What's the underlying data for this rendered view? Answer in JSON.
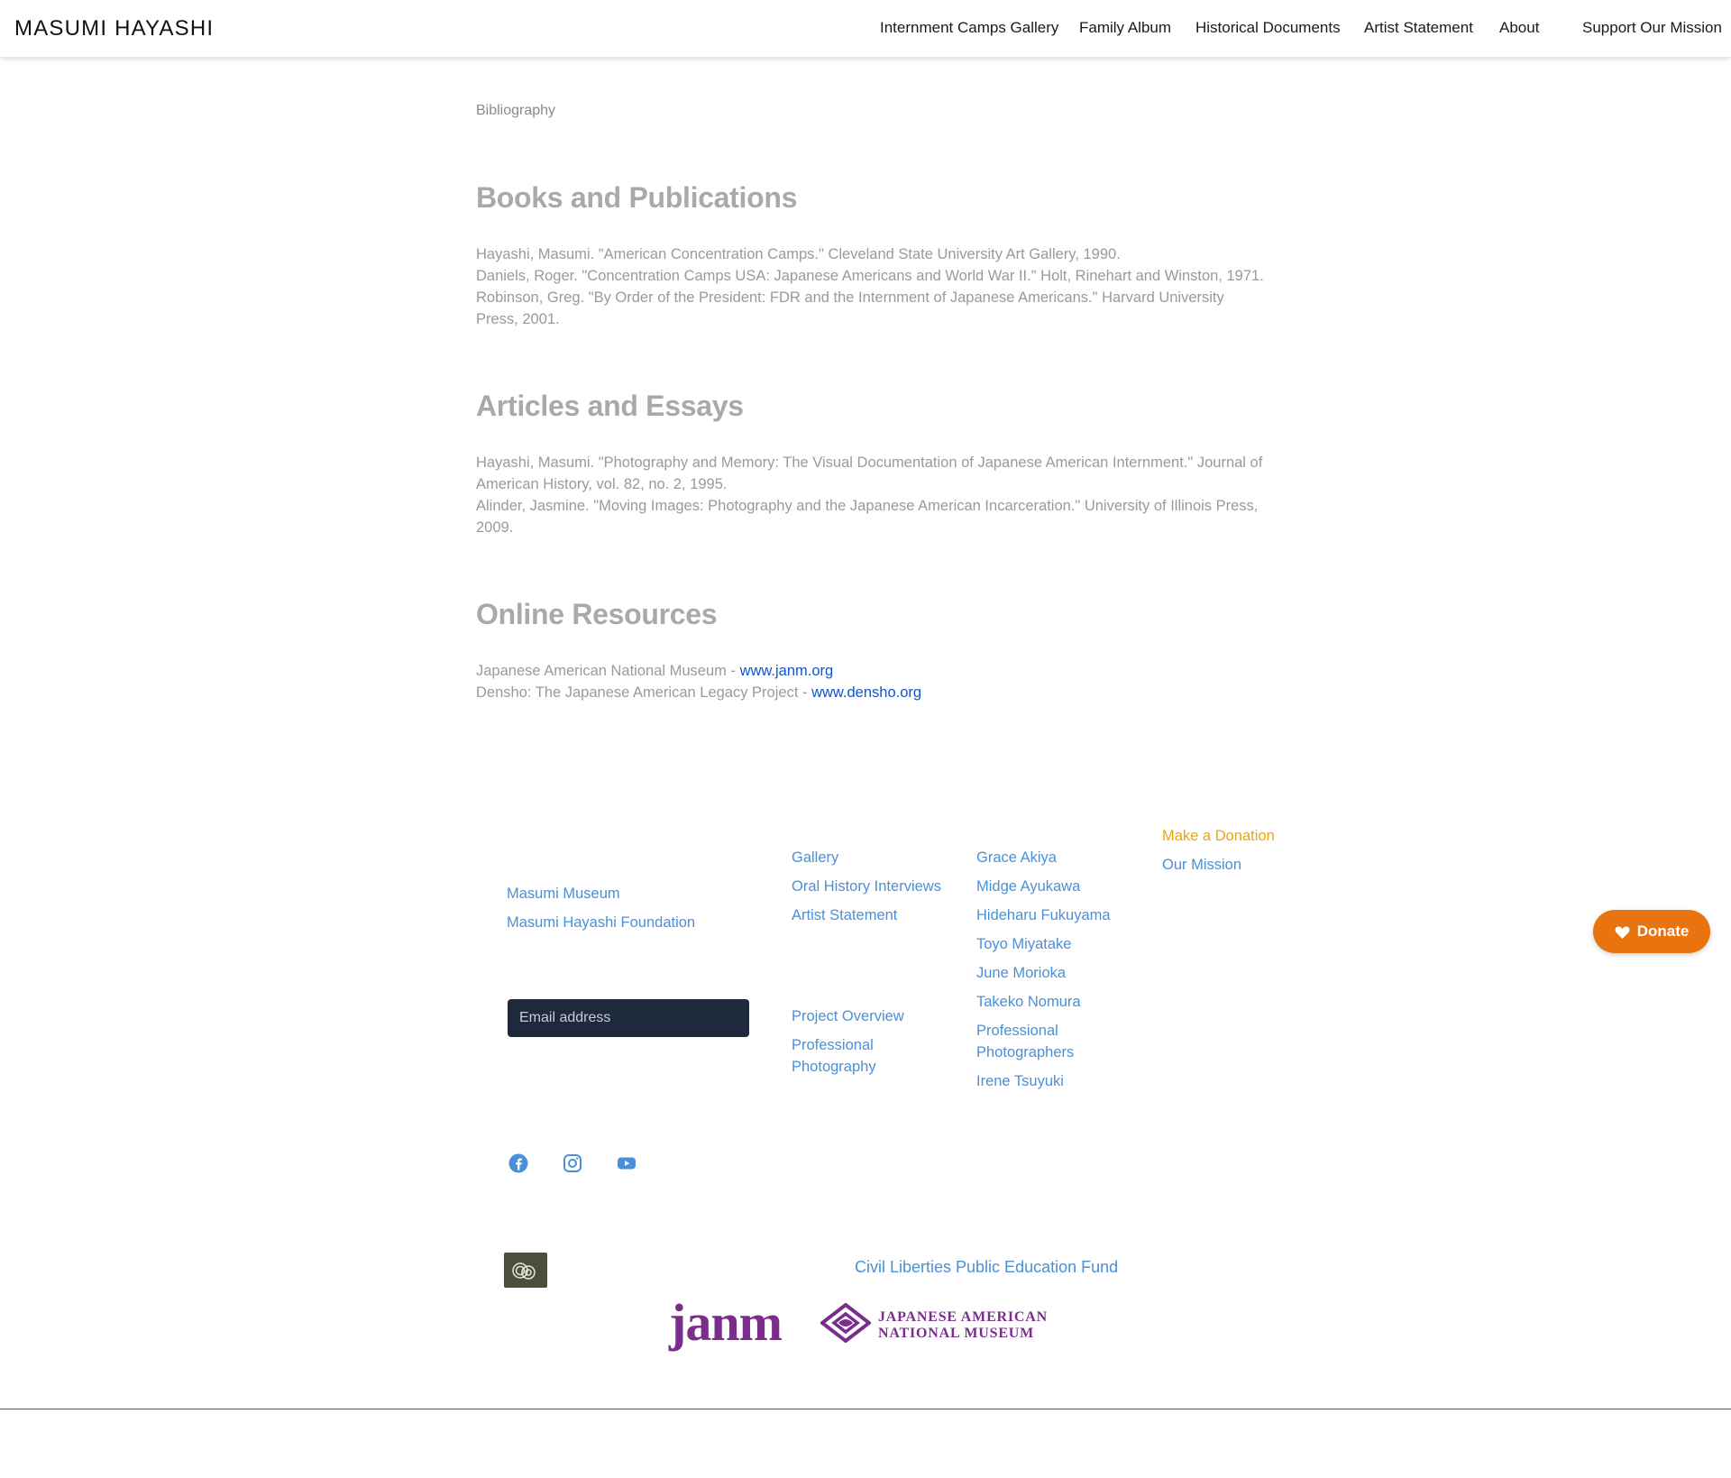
{
  "header": {
    "brand": "MASUMI HAYASHI",
    "nav": [
      {
        "label": "Internment Camps Gallery"
      },
      {
        "label": "Family Album"
      },
      {
        "label": "Historical Documents"
      },
      {
        "label": "Artist Statement"
      },
      {
        "label": "About"
      },
      {
        "label": "Support Our Mission"
      }
    ]
  },
  "main": {
    "breadcrumb": "Bibliography",
    "sections": [
      {
        "title": "Books and Publications",
        "entries": [
          "Hayashi, Masumi. \"American Concentration Camps.\" Cleveland State University Art Gallery, 1990.",
          "Daniels, Roger. \"Concentration Camps USA: Japanese Americans and World War II.\" Holt, Rinehart and Winston, 1971.",
          "Robinson, Greg. \"By Order of the President: FDR and the Internment of Japanese Americans.\" Harvard University Press, 2001."
        ]
      },
      {
        "title": "Articles and Essays",
        "entries": [
          "Hayashi, Masumi. \"Photography and Memory: The Visual Documentation of Japanese American Internment.\" Journal of American History, vol. 82, no. 2, 1995.",
          "Alinder, Jasmine. \"Moving Images: Photography and the Japanese American Incarceration.\" University of Illinois Press, 2009."
        ]
      },
      {
        "title": "Online Resources",
        "resources": [
          {
            "text": "Japanese American National Museum - ",
            "link": "www.janm.org"
          },
          {
            "text": "Densho: The Japanese American Legacy Project - ",
            "link": "www.densho.org"
          }
        ]
      }
    ]
  },
  "footer": {
    "col1": [
      "Masumi Museum",
      "Masumi Hayashi Foundation"
    ],
    "email_placeholder": "Email address",
    "col2_top": [
      "Gallery",
      "Oral History Interviews",
      "Artist Statement"
    ],
    "col2_bottom": [
      "Project Overview",
      "Professional Photography"
    ],
    "col3": [
      "Grace Akiya",
      "Midge Ayukawa",
      "Hideharu Fukuyama",
      "Toyo Miyatake",
      "June Morioka",
      "Takeko Nomura",
      "Professional Photographers",
      "Irene Tsuyuki"
    ],
    "col4": [
      "Make a Donation",
      "Our Mission"
    ],
    "social_icons": [
      "facebook-icon",
      "instagram-icon",
      "youtube-icon"
    ],
    "clpef_label": "Civil Liberties Public Education Fund",
    "janm": {
      "wordmark": "janm",
      "line1": "JAPANESE AMERICAN",
      "line2": "NATIONAL MUSEUM"
    }
  },
  "donate_button": {
    "label": "Donate",
    "icon": "heart-icon"
  },
  "colors": {
    "link": "#4a90d9",
    "gold_link": "#f0a500",
    "donate": "#e8730f",
    "janm_purple": "#7b2d8e",
    "email_field": "#1e293b"
  }
}
